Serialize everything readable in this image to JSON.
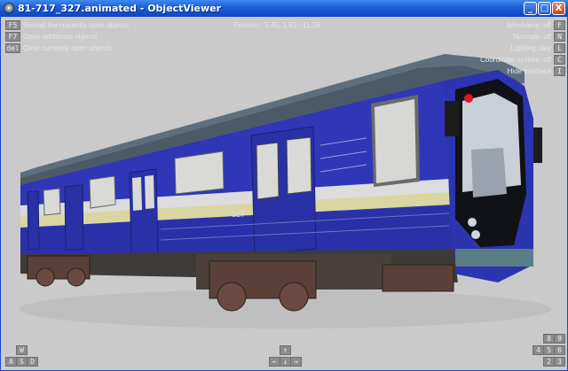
{
  "window": {
    "title": "81-717_327.animated - ObjectViewer",
    "buttons": {
      "minimize": "_",
      "maximize": "□",
      "close": "X"
    }
  },
  "overlay": {
    "left_items": [
      {
        "key": "F5",
        "label": "Reload the currently open objects"
      },
      {
        "key": "F7",
        "label": "Open additional objects"
      },
      {
        "key": "del",
        "label": "Clear currently open objects"
      }
    ],
    "position": "Position: -5.45, 1.61, -11.26",
    "right_items": [
      {
        "key": "F",
        "label": "Wireframe: off"
      },
      {
        "key": "N",
        "label": "Normals: off"
      },
      {
        "key": "L",
        "label": "Lighting: day"
      },
      {
        "key": "C",
        "label": "Coordinate system: off"
      },
      {
        "key": "I",
        "label": "Hide interface"
      }
    ],
    "bottom_left_keys": {
      "top": "W",
      "row": [
        "A",
        "S",
        "D"
      ]
    },
    "bottom_center_keys": {
      "top": "↑",
      "row": [
        "←",
        "↓",
        "→"
      ]
    },
    "bottom_right_keys": {
      "top": [
        "8",
        "9"
      ],
      "mid": [
        "4",
        "5",
        "6"
      ],
      "bot": [
        "2",
        "3"
      ]
    }
  },
  "scene": {
    "car_number": "327",
    "colors": {
      "background": "#cacaca",
      "body_blue": "#2f36b8",
      "stripe": "#d9d6a4",
      "underframe": "#3e3a38"
    }
  }
}
